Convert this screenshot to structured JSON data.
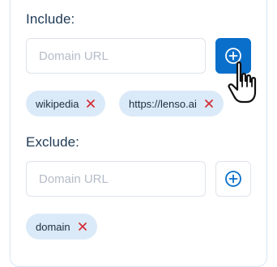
{
  "include": {
    "title": "Include:",
    "input_placeholder": "Domain URL",
    "add_button_state": "active",
    "chips": [
      {
        "label": "wikipedia"
      },
      {
        "label": "https://lenso.ai"
      }
    ]
  },
  "exclude": {
    "title": "Exclude:",
    "input_placeholder": "Domain URL",
    "add_button_state": "idle",
    "chips": [
      {
        "label": "domain"
      }
    ]
  },
  "icons": {
    "add": "plus-circle-icon",
    "remove": "x-icon",
    "cursor": "hand-pointer-icon"
  },
  "colors": {
    "accent": "#0a6fca",
    "chip_bg": "#dbeaf8",
    "remove_x": "#d3303a",
    "title_text": "#1f3a55"
  }
}
